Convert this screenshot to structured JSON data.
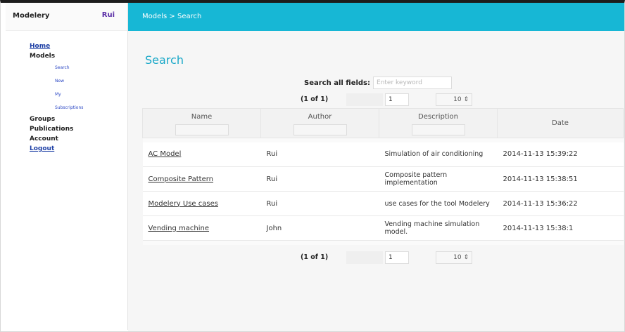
{
  "app": {
    "brand": "Modelery",
    "user": "Rui"
  },
  "sidebar": {
    "items": [
      {
        "label": "Home"
      },
      {
        "label": "Models"
      },
      {
        "label": "Search"
      },
      {
        "label": "New"
      },
      {
        "label": "My"
      },
      {
        "label": "Subscriptions"
      },
      {
        "label": "Groups"
      },
      {
        "label": "Publications"
      },
      {
        "label": "Account"
      },
      {
        "label": "Logout"
      }
    ]
  },
  "header": {
    "breadcrumb": "Models > Search"
  },
  "main": {
    "title": "Search",
    "search": {
      "label": "Search all fields:",
      "placeholder": "Enter keyword",
      "value": ""
    },
    "pager": {
      "count": "(1 of 1)",
      "page": "1",
      "rows": "10 ⇕"
    },
    "table": {
      "headers": {
        "name": "Name",
        "author": "Author",
        "description": "Description",
        "date": "Date"
      },
      "rows": [
        {
          "name": "AC Model",
          "author": "Rui",
          "description": "Simulation of air conditioning",
          "date": "2014-11-13 15:39:22"
        },
        {
          "name": "Composite Pattern",
          "author": "Rui",
          "description": "Composite pattern implementation",
          "date": "2014-11-13 15:38:51"
        },
        {
          "name": "Modelery Use cases",
          "author": "Rui",
          "description": "use cases for the tool Modelery",
          "date": "2014-11-13 15:36:22"
        },
        {
          "name": "Vending machine",
          "author": "John",
          "description": "Vending machine simulation model.",
          "date": "2014-11-13 15:38:1"
        }
      ]
    }
  },
  "colors": {
    "accent": "#17b7d5",
    "title": "#19a8c8",
    "link": "#1d3fa5",
    "user": "#5a2ea6"
  }
}
